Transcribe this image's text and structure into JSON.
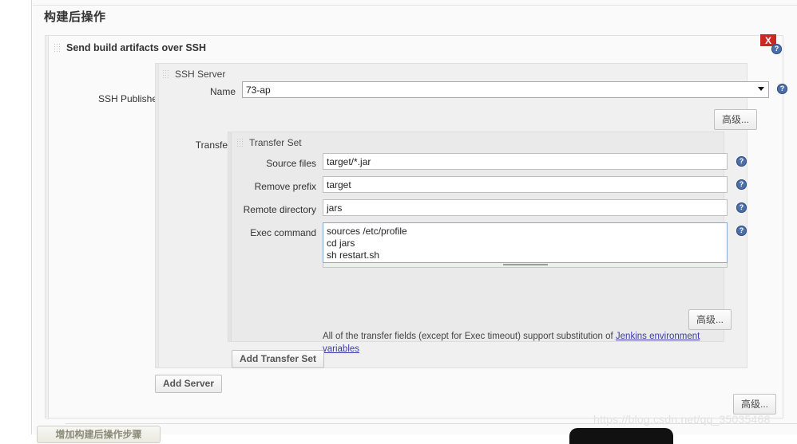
{
  "page": {
    "section_title": "构建后操作",
    "watermark": "https://blog.csdn.net/qq_35035468",
    "bottom_button_label": "增加构建后操作步骤"
  },
  "publisher": {
    "title": "Send build artifacts over SSH",
    "delete_label": "X",
    "help_label": "?",
    "advanced_label": "高级...",
    "add_server_label": "Add Server",
    "publishers_row_label": "SSH Publishers"
  },
  "server": {
    "panel_title": "SSH Server",
    "name_label": "Name",
    "name_value": "73-ap",
    "name_options": [
      "73-ap"
    ],
    "advanced_label": "高级...",
    "help_label": "?",
    "transfers_label": "Transfers"
  },
  "transfer_set": {
    "panel_title": "Transfer Set",
    "advanced_label": "高级...",
    "add_transfer_set_label": "Add Transfer Set",
    "help_label": "?",
    "fields": [
      {
        "label": "Source files",
        "value": "target/*.jar",
        "placeholder": ""
      },
      {
        "label": "Remove prefix",
        "value": "target",
        "placeholder": ""
      },
      {
        "label": "Remote directory",
        "value": "jars",
        "placeholder": ""
      }
    ],
    "exec": {
      "label": "Exec command",
      "value": "sources /etc/profile\ncd jars\nsh restart.sh",
      "placeholder": ""
    },
    "note_prefix": "All of the transfer fields (except for Exec timeout) support substitution of ",
    "note_link": "Jenkins environment variables"
  },
  "colors": {
    "accent_help": "#4d6fa8",
    "danger": "#cc2822",
    "link": "#3a3ab0",
    "panel_bg": "#f0f0f0",
    "inner_panel_bg": "#eaeaea"
  }
}
